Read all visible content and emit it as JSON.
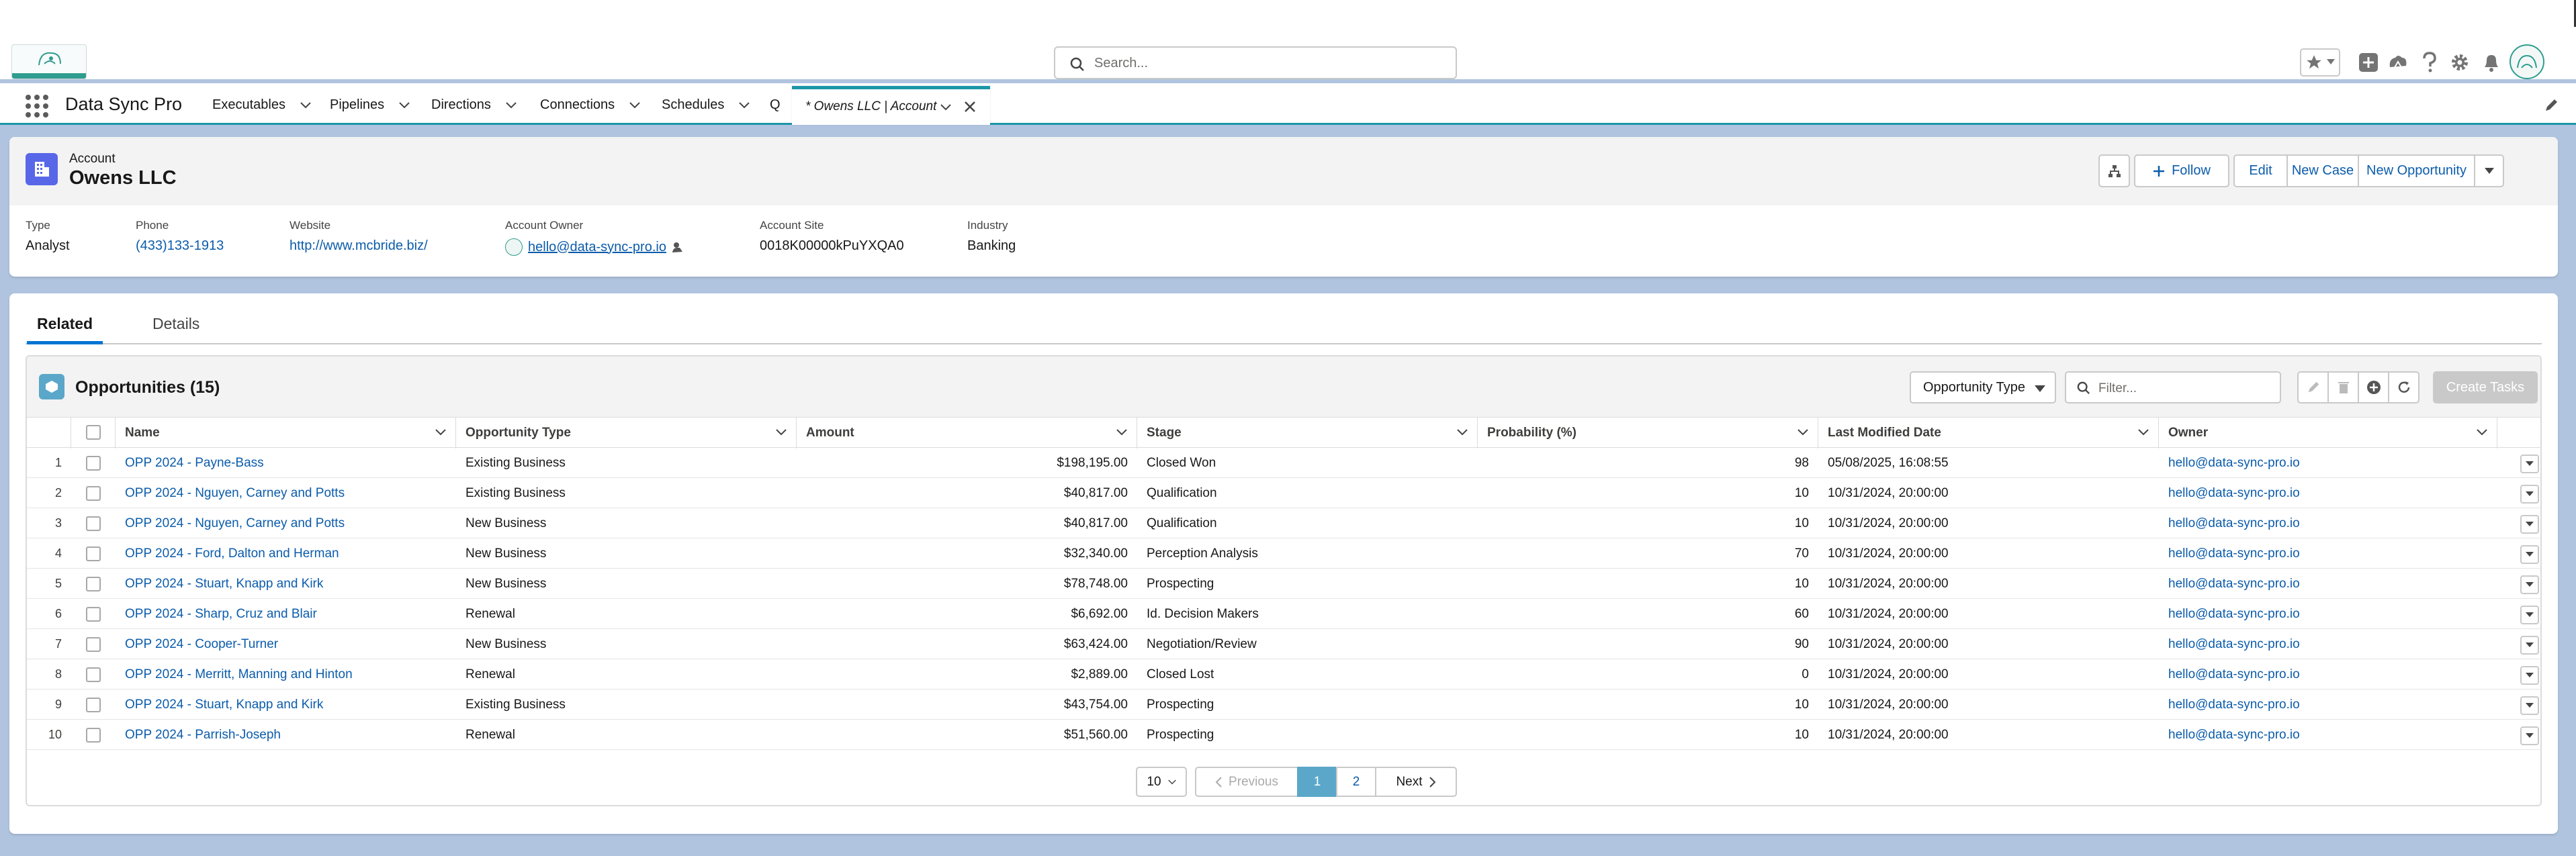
{
  "global_header": {
    "search_placeholder": "Search...",
    "icons": [
      "favorites-star-icon",
      "favorites-dropdown-icon",
      "global-add-icon",
      "trailhead-icon",
      "help-icon",
      "setup-gear-icon",
      "notifications-bell-icon",
      "user-avatar"
    ]
  },
  "nav": {
    "app_name": "Data Sync Pro",
    "items": [
      {
        "label": "Executables"
      },
      {
        "label": "Pipelines"
      },
      {
        "label": "Directions"
      },
      {
        "label": "Connections"
      },
      {
        "label": "Schedules"
      },
      {
        "label": "Q"
      }
    ],
    "current_tab": "* Owens LLC | Account"
  },
  "record": {
    "object_label": "Account",
    "name": "Owens LLC",
    "actions": {
      "follow": "Follow",
      "edit": "Edit",
      "new_case": "New Case",
      "new_opportunity": "New Opportunity"
    },
    "fields": {
      "type": {
        "label": "Type",
        "value": "Analyst"
      },
      "phone": {
        "label": "Phone",
        "value": "(433)133-1913"
      },
      "website": {
        "label": "Website",
        "value": "http://www.mcbride.biz/"
      },
      "owner": {
        "label": "Account Owner",
        "value": "hello@data-sync-pro.io"
      },
      "site": {
        "label": "Account Site",
        "value": "0018K00000kPuYXQA0"
      },
      "industry": {
        "label": "Industry",
        "value": "Banking"
      }
    }
  },
  "tabs": {
    "related": "Related",
    "details": "Details"
  },
  "related_list": {
    "title": "Opportunities (15)",
    "type_select": "Opportunity Type",
    "filter_placeholder": "Filter...",
    "create_tasks": "Create Tasks",
    "columns": {
      "name": "Name",
      "type": "Opportunity Type",
      "amount": "Amount",
      "stage": "Stage",
      "probability": "Probability (%)",
      "modified": "Last Modified Date",
      "owner": "Owner"
    },
    "rows": [
      {
        "num": "1",
        "name": "OPP 2024 - Payne-Bass",
        "type": "Existing Business",
        "amount": "$198,195.00",
        "stage": "Closed Won",
        "probability": "98",
        "modified": "05/08/2025, 16:08:55",
        "owner": "hello@data-sync-pro.io"
      },
      {
        "num": "2",
        "name": "OPP 2024 - Nguyen, Carney and Potts",
        "type": "Existing Business",
        "amount": "$40,817.00",
        "stage": "Qualification",
        "probability": "10",
        "modified": "10/31/2024, 20:00:00",
        "owner": "hello@data-sync-pro.io"
      },
      {
        "num": "3",
        "name": "OPP 2024 - Nguyen, Carney and Potts",
        "type": "New Business",
        "amount": "$40,817.00",
        "stage": "Qualification",
        "probability": "10",
        "modified": "10/31/2024, 20:00:00",
        "owner": "hello@data-sync-pro.io"
      },
      {
        "num": "4",
        "name": "OPP 2024 - Ford, Dalton and Herman",
        "type": "New Business",
        "amount": "$32,340.00",
        "stage": "Perception Analysis",
        "probability": "70",
        "modified": "10/31/2024, 20:00:00",
        "owner": "hello@data-sync-pro.io"
      },
      {
        "num": "5",
        "name": "OPP 2024 - Stuart, Knapp and Kirk",
        "type": "New Business",
        "amount": "$78,748.00",
        "stage": "Prospecting",
        "probability": "10",
        "modified": "10/31/2024, 20:00:00",
        "owner": "hello@data-sync-pro.io"
      },
      {
        "num": "6",
        "name": "OPP 2024 - Sharp, Cruz and Blair",
        "type": "Renewal",
        "amount": "$6,692.00",
        "stage": "Id. Decision Makers",
        "probability": "60",
        "modified": "10/31/2024, 20:00:00",
        "owner": "hello@data-sync-pro.io"
      },
      {
        "num": "7",
        "name": "OPP 2024 - Cooper-Turner",
        "type": "New Business",
        "amount": "$63,424.00",
        "stage": "Negotiation/Review",
        "probability": "90",
        "modified": "10/31/2024, 20:00:00",
        "owner": "hello@data-sync-pro.io"
      },
      {
        "num": "8",
        "name": "OPP 2024 - Merritt, Manning and Hinton",
        "type": "Renewal",
        "amount": "$2,889.00",
        "stage": "Closed Lost",
        "probability": "0",
        "modified": "10/31/2024, 20:00:00",
        "owner": "hello@data-sync-pro.io"
      },
      {
        "num": "9",
        "name": "OPP 2024 - Stuart, Knapp and Kirk",
        "type": "Existing Business",
        "amount": "$43,754.00",
        "stage": "Prospecting",
        "probability": "10",
        "modified": "10/31/2024, 20:00:00",
        "owner": "hello@data-sync-pro.io"
      },
      {
        "num": "10",
        "name": "OPP 2024 - Parrish-Joseph",
        "type": "Renewal",
        "amount": "$51,560.00",
        "stage": "Prospecting",
        "probability": "10",
        "modified": "10/31/2024, 20:00:00",
        "owner": "hello@data-sync-pro.io"
      }
    ],
    "pager": {
      "page_size": "10",
      "previous": "Previous",
      "pages": [
        "1",
        "2"
      ],
      "current": "1",
      "next": "Next"
    }
  },
  "colors": {
    "brand": "#0176d3",
    "link": "#0b5cab",
    "accent": "#1b96a8",
    "background": "#b0c4df",
    "account_icon": "#5867e8",
    "opportunity_icon": "#5ba7c9"
  }
}
